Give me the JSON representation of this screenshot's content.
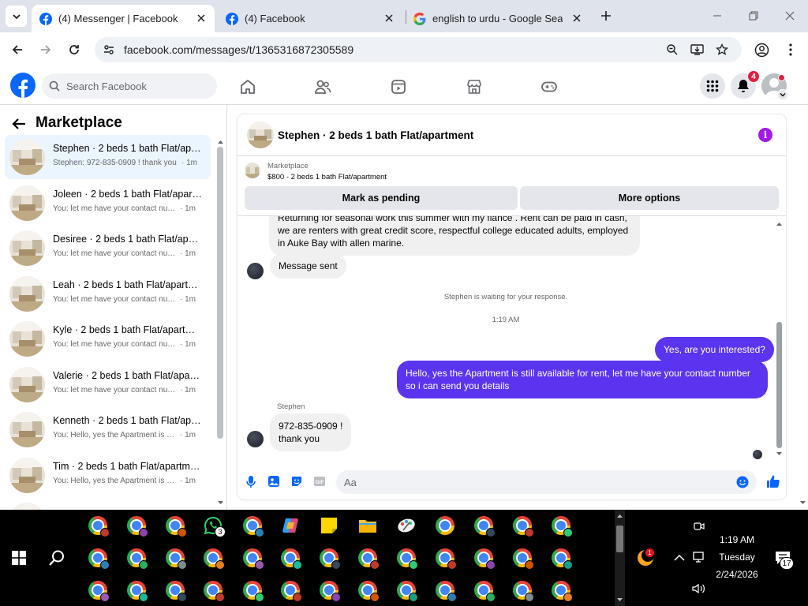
{
  "browser": {
    "tabs": [
      {
        "title": "(4) Messenger | Facebook",
        "icon": "facebook-icon",
        "active": true
      },
      {
        "title": "(4) Facebook",
        "icon": "facebook-icon",
        "active": false
      },
      {
        "title": "english to urdu - Google Search",
        "icon": "google-icon",
        "active": false
      }
    ],
    "url": "facebook.com/messages/t/1365316872305589"
  },
  "fb_header": {
    "search_placeholder": "Search Facebook",
    "notification_count": "4",
    "brand_color": "#0866ff"
  },
  "sidebar": {
    "title": "Marketplace",
    "conversations": [
      {
        "name": "Stephen · 2 beds 1 bath Flat/apartment",
        "preview": "Stephen: 972-835-0909 ! thank you",
        "time": "· 1m",
        "selected": true
      },
      {
        "name": "Joleen · 2 beds 1 bath Flat/apartment",
        "preview": "You: let me have your contact number",
        "time": "· 1m",
        "selected": false
      },
      {
        "name": "Desiree · 2 beds 1 bath Flat/apartment",
        "preview": "You: let me have your contact number",
        "time": "· 1m",
        "selected": false
      },
      {
        "name": "Leah · 2 beds 1 bath Flat/apartment",
        "preview": "You: let me have your contact number",
        "time": "· 1m",
        "selected": false
      },
      {
        "name": "Kyle · 2 beds 1 bath Flat/apartment",
        "preview": "You: let me have your contact number",
        "time": "· 1m",
        "selected": false
      },
      {
        "name": "Valerie · 2 beds 1 bath Flat/apartment",
        "preview": "You: let me have your contact number",
        "time": "· 1m",
        "selected": false
      },
      {
        "name": "Kenneth · 2 beds 1 bath Flat/apartment",
        "preview": "You: Hello, yes the Apartment is still available",
        "time": "· 1m",
        "selected": false
      },
      {
        "name": "Tim · 2 beds 1 bath Flat/apartment",
        "preview": "You: Hello, yes the Apartment is still available",
        "time": "· 1m",
        "selected": false
      }
    ]
  },
  "chat": {
    "title": "Stephen · 2 beds 1 bath Flat/apartment",
    "marketplace_label": "Marketplace",
    "listing": "$800 - 2 beds 1 bath Flat/apartment",
    "mark_pending": "Mark as pending",
    "more_options": "More options",
    "messages": {
      "partial_top": "Returning for seasonal work this summer with my fiancé . Rent can be paid in cash,",
      "incoming_long": "we are renters with great credit score, respectful college educated adults, employed in Auke Bay with allen marine.",
      "incoming_sent": "Message sent",
      "waiting_notice": "Stephen is waiting for your response.",
      "timestamp": "1:19 AM",
      "out_1": "Yes, are you interested?",
      "out_2": "Hello, yes the Apartment is still available for rent, let me have your contact number so i can send you details",
      "sender_name": "Stephen",
      "in_last_line1": "972-835-0909 !",
      "in_last_line2": "thank you"
    },
    "composer_placeholder": "Aa",
    "accent_color": "#5b34f0"
  },
  "taskbar": {
    "whatsapp_badge": "3",
    "tray_badge": "1",
    "time": "1:19 AM",
    "day": "Tuesday",
    "date": "2/24/2026",
    "notification_count": "17"
  }
}
